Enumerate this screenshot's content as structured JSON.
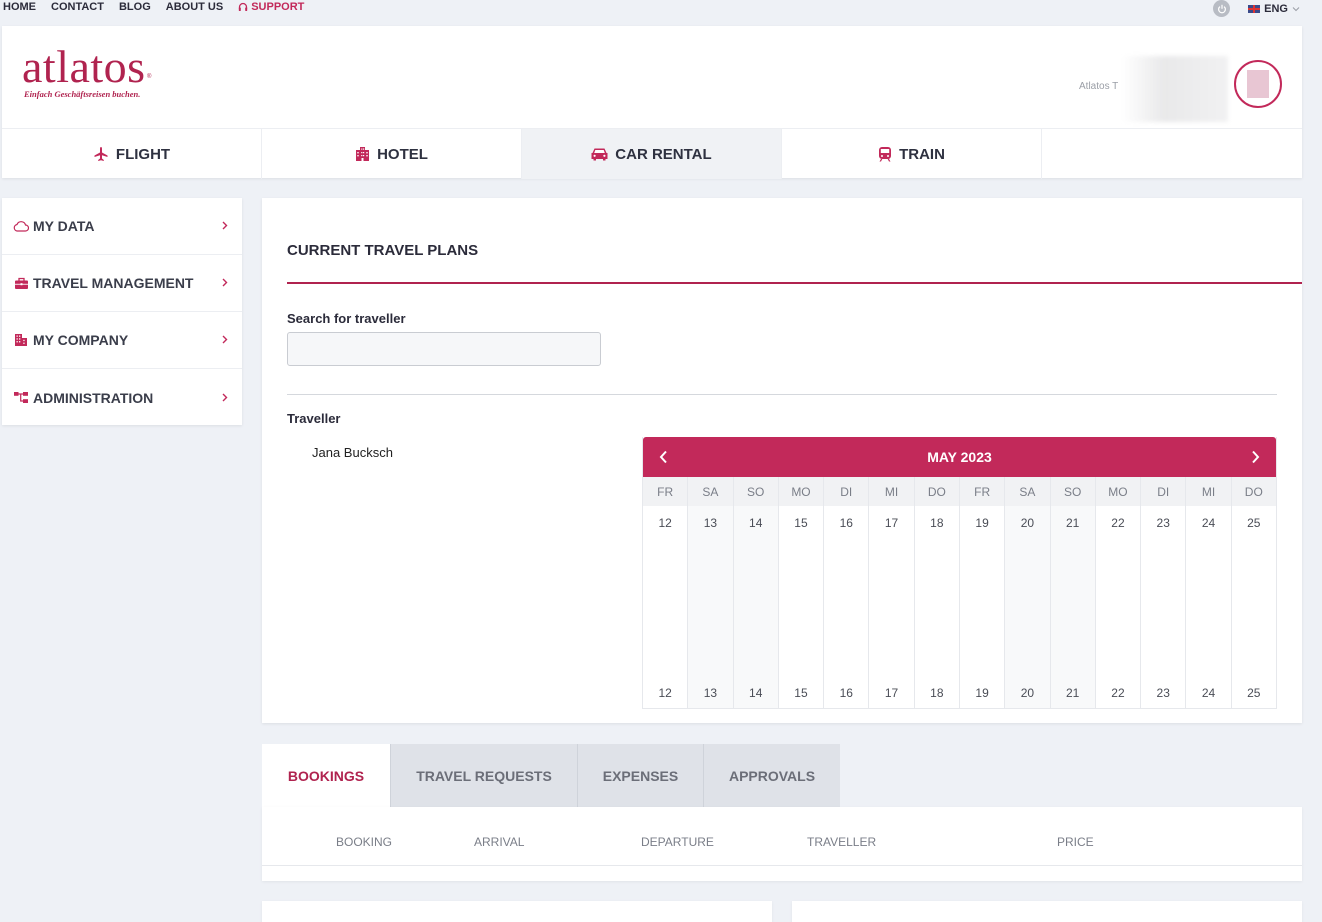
{
  "topnav": {
    "home": "HOME",
    "contact": "CONTACT",
    "blog": "BLOG",
    "about": "ABOUT US",
    "support": "SUPPORT",
    "language": "ENG"
  },
  "header": {
    "logo_text": "atlatos",
    "logo_tagline": "Einfach Geschäftsreisen buchen.",
    "user_name": "Atlatos T"
  },
  "main_tabs": [
    {
      "label": "FLIGHT",
      "icon": "plane-icon"
    },
    {
      "label": "HOTEL",
      "icon": "building-icon"
    },
    {
      "label": "CAR RENTAL",
      "icon": "car-icon"
    },
    {
      "label": "TRAIN",
      "icon": "train-icon"
    }
  ],
  "active_main_tab": "CAR RENTAL",
  "sidebar": {
    "items": [
      {
        "label": "MY DATA",
        "icon": "cloud-icon"
      },
      {
        "label": "TRAVEL MANAGEMENT",
        "icon": "briefcase-icon"
      },
      {
        "label": "MY COMPANY",
        "icon": "company-icon"
      },
      {
        "label": "ADMINISTRATION",
        "icon": "sitemap-icon"
      }
    ]
  },
  "travel_plans": {
    "title": "CURRENT TRAVEL PLANS",
    "search_label": "Search for traveller",
    "search_value": "",
    "traveller_label": "Traveller",
    "travellers": [
      "Jana Bucksch"
    ]
  },
  "calendar": {
    "month": "MAY 2023",
    "days": [
      {
        "name": "FR",
        "num": "12"
      },
      {
        "name": "SA",
        "num": "13"
      },
      {
        "name": "SO",
        "num": "14"
      },
      {
        "name": "MO",
        "num": "15"
      },
      {
        "name": "DI",
        "num": "16"
      },
      {
        "name": "MI",
        "num": "17"
      },
      {
        "name": "DO",
        "num": "18"
      },
      {
        "name": "FR",
        "num": "19"
      },
      {
        "name": "SA",
        "num": "20"
      },
      {
        "name": "SO",
        "num": "21"
      },
      {
        "name": "MO",
        "num": "22"
      },
      {
        "name": "DI",
        "num": "23"
      },
      {
        "name": "MI",
        "num": "24"
      },
      {
        "name": "DO",
        "num": "25"
      }
    ]
  },
  "bottom_tabs": [
    {
      "label": "BOOKINGS"
    },
    {
      "label": "TRAVEL REQUESTS"
    },
    {
      "label": "EXPENSES"
    },
    {
      "label": "APPROVALS"
    }
  ],
  "active_bottom_tab": "BOOKINGS",
  "bookings_table": {
    "columns": [
      "BOOKING",
      "ARRIVAL",
      "DEPARTURE",
      "TRAVELLER",
      "PRICE"
    ]
  },
  "colors": {
    "accent": "#c2295a",
    "brand": "#b0234f"
  }
}
